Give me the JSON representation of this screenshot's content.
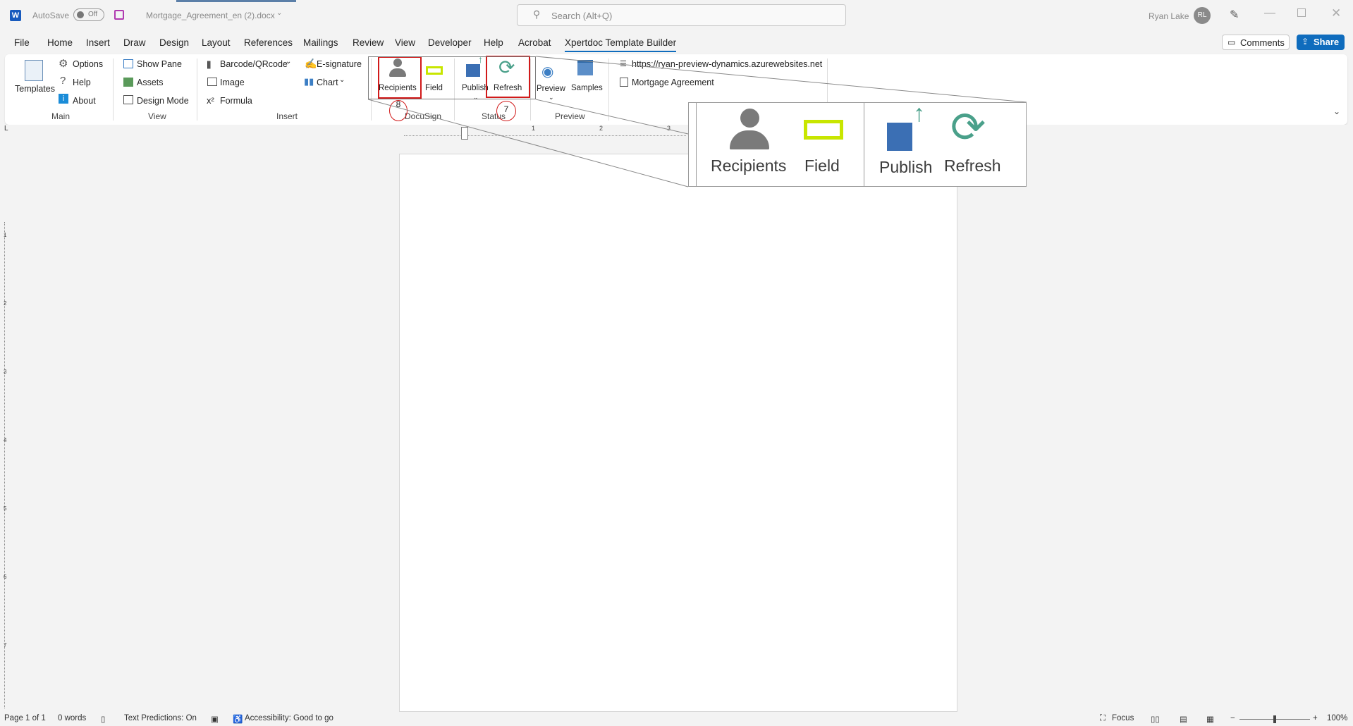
{
  "titlebar": {
    "autosave_label": "AutoSave",
    "autosave_state": "Off",
    "filename": "Mortgage_Agreement_en (2).docx",
    "search_placeholder": "Search (Alt+Q)",
    "user_name": "Ryan Lake",
    "user_initials": "RL"
  },
  "menu": [
    "File",
    "Home",
    "Insert",
    "Draw",
    "Design",
    "Layout",
    "References",
    "Mailings",
    "Review",
    "View",
    "Developer",
    "Help",
    "Acrobat",
    "Xpertdoc Template Builder"
  ],
  "actions": {
    "comments": "Comments",
    "share": "Share"
  },
  "ribbon": {
    "templates": "Templates",
    "options": "Options",
    "help": "Help",
    "about": "About",
    "group_main": "Main",
    "show_pane": "Show Pane",
    "assets": "Assets",
    "design_mode": "Design Mode",
    "group_view": "View",
    "barcode": "Barcode/QRcode",
    "image": "Image",
    "formula": "Formula",
    "esignature": "E-signature",
    "chart": "Chart",
    "group_insert": "Insert",
    "recipients": "Recipients",
    "field": "Field",
    "group_docusign": "DocuSign",
    "publish": "Publish",
    "refresh": "Refresh",
    "group_status": "Status",
    "preview": "Preview",
    "samples": "Samples",
    "group_preview": "Preview",
    "url": "https://ryan-preview-dynamics.azurewebsites.net",
    "template_name": "Mortgage Agreement"
  },
  "annotations": {
    "circle_8": "8",
    "circle_7": "7"
  },
  "zoom_callout": {
    "recipients": "Recipients",
    "field": "Field",
    "publish": "Publish",
    "refresh": "Refresh"
  },
  "ruler": {
    "h_marks": [
      "1",
      "2",
      "3"
    ],
    "v_marks": [
      "1",
      "2",
      "3",
      "4",
      "5",
      "6",
      "7"
    ]
  },
  "statusbar": {
    "page": "Page 1 of 1",
    "words": "0 words",
    "text_predictions": "Text Predictions: On",
    "accessibility": "Accessibility: Good to go",
    "focus": "Focus",
    "zoom": "100%"
  },
  "colors": {
    "accent": "#0f6cbd",
    "red_highlight": "#d11a1a",
    "teal_icon": "#4aa08a",
    "field_yellow": "#c8e600"
  }
}
